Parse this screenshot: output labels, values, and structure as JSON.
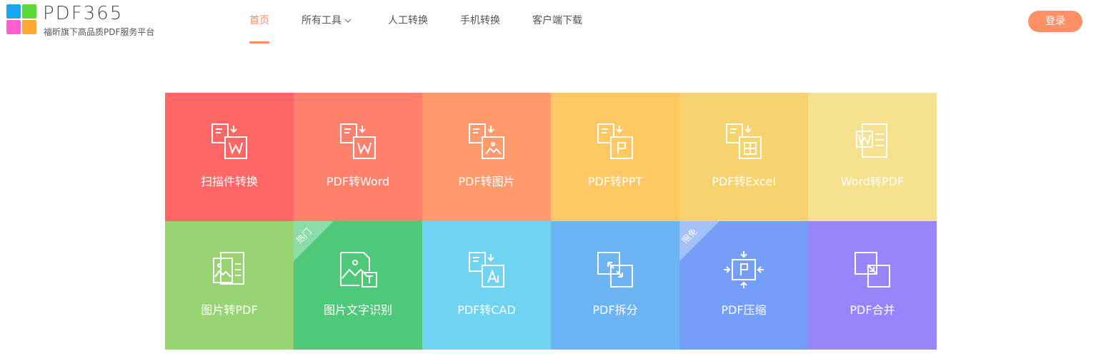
{
  "brand": {
    "name": "PDF365",
    "slogan": "福昕旗下高品质PDF服务平台",
    "colors": [
      "#1aa7f0",
      "#5ad93a",
      "#ff5fd1",
      "#ffa733"
    ]
  },
  "nav": {
    "items": [
      {
        "label": "首页",
        "active": true
      },
      {
        "label": "所有工具",
        "has_dropdown": true
      },
      {
        "label": "人工转换"
      },
      {
        "label": "手机转换"
      },
      {
        "label": "客户端下载"
      }
    ],
    "accent": "#ff8a5c"
  },
  "header": {
    "login_label": "登录"
  },
  "tools": [
    {
      "label": "扫描件转换",
      "color": "#ff6766",
      "icon": "scan-to-word-icon"
    },
    {
      "label": "PDF转Word",
      "color": "#ff806b",
      "icon": "pdf-to-word-icon"
    },
    {
      "label": "PDF转图片",
      "color": "#ff9a6c",
      "icon": "pdf-to-image-icon"
    },
    {
      "label": "PDF转PPT",
      "color": "#ffc862",
      "icon": "pdf-to-ppt-icon"
    },
    {
      "label": "PDF转Excel",
      "color": "#f7d36e",
      "icon": "pdf-to-excel-icon"
    },
    {
      "label": "Word转PDF",
      "color": "#f5e18e",
      "icon": "word-to-pdf-icon"
    },
    {
      "label": "图片转PDF",
      "color": "#98d474",
      "icon": "image-to-pdf-icon"
    },
    {
      "label": "图片文字识别",
      "color": "#4ec97a",
      "icon": "image-ocr-icon",
      "badge": "热门"
    },
    {
      "label": "PDF转CAD",
      "color": "#6fd3f1",
      "icon": "pdf-to-cad-icon"
    },
    {
      "label": "PDF拆分",
      "color": "#6cb4f4",
      "icon": "pdf-split-icon"
    },
    {
      "label": "PDF压缩",
      "color": "#749ef8",
      "icon": "pdf-compress-icon",
      "badge": "限免"
    },
    {
      "label": "PDF合并",
      "color": "#9884fb",
      "icon": "pdf-merge-icon"
    }
  ]
}
